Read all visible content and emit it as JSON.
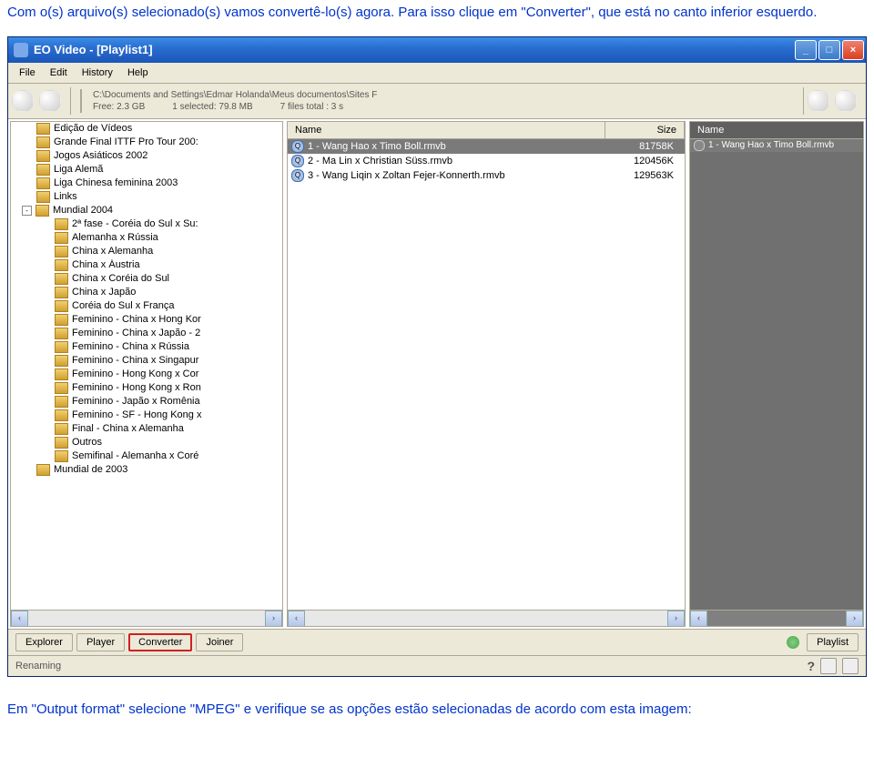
{
  "intro": "Com o(s) arquivo(s) selecionado(s) vamos convertê-lo(s) agora. Para isso clique em \"Converter\", que está no canto inferior esquerdo.",
  "outro": "Em \"Output format\" selecione \"MPEG\" e verifique se as opções estão selecionadas de acordo com esta imagem:",
  "title": "EO Video - [Playlist1]",
  "menu": {
    "file": "File",
    "edit": "Edit",
    "history": "History",
    "help": "Help"
  },
  "path": {
    "line1": "C:\\Documents and Settings\\Edmar Holanda\\Meus documentos\\Sites F",
    "free": "Free: 2.3 GB",
    "sel": "1 selected: 79.8 MB",
    "total": "7 files  total : 3 s"
  },
  "cols": {
    "name": "Name",
    "size": "Size"
  },
  "tree": [
    {
      "label": "Edição de Vídeos",
      "depth": 0
    },
    {
      "label": "Grande Final ITTF Pro Tour 200:",
      "depth": 0
    },
    {
      "label": "Jogos Asiáticos 2002",
      "depth": 0
    },
    {
      "label": "Liga Alemã",
      "depth": 0
    },
    {
      "label": "Liga Chinesa feminina 2003",
      "depth": 0
    },
    {
      "label": "Links",
      "depth": 0
    },
    {
      "label": "Mundial 2004",
      "depth": 0,
      "exp": "-"
    },
    {
      "label": "2ª fase - Coréia do Sul x Su:",
      "depth": 1
    },
    {
      "label": "Alemanha x Rússia",
      "depth": 1
    },
    {
      "label": "China x Alemanha",
      "depth": 1
    },
    {
      "label": "China x Áustria",
      "depth": 1
    },
    {
      "label": "China x Coréia do Sul",
      "depth": 1
    },
    {
      "label": "China x Japão",
      "depth": 1
    },
    {
      "label": "Coréia do Sul x França",
      "depth": 1
    },
    {
      "label": "Feminino - China x Hong Kor",
      "depth": 1
    },
    {
      "label": "Feminino - China x Japão - 2",
      "depth": 1
    },
    {
      "label": "Feminino - China x Rússia",
      "depth": 1
    },
    {
      "label": "Feminino - China x Singapur",
      "depth": 1
    },
    {
      "label": "Feminino - Hong Kong x Cor",
      "depth": 1
    },
    {
      "label": "Feminino - Hong Kong x Ron",
      "depth": 1
    },
    {
      "label": "Feminino - Japão x Romênia",
      "depth": 1
    },
    {
      "label": "Feminino - SF - Hong Kong x",
      "depth": 1
    },
    {
      "label": "Final - China x Alemanha",
      "depth": 1
    },
    {
      "label": "Outros",
      "depth": 1
    },
    {
      "label": "Semifinal - Alemanha x Coré",
      "depth": 1
    },
    {
      "label": "Mundial de 2003",
      "depth": 0
    }
  ],
  "files": [
    {
      "name": "1 - Wang Hao x Timo Boll.rmvb",
      "size": "81758K",
      "sel": true
    },
    {
      "name": "2 - Ma Lin x Christian Süss.rmvb",
      "size": "120456K"
    },
    {
      "name": "3 - Wang Liqin x Zoltan Fejer-Konnerth.rmvb",
      "size": "129563K"
    }
  ],
  "playlist": [
    {
      "name": "1 - Wang Hao x Timo Boll.rmvb"
    }
  ],
  "tabs": {
    "explorer": "Explorer",
    "player": "Player",
    "converter": "Converter",
    "joiner": "Joiner",
    "playlist": "Playlist"
  },
  "status": {
    "left": "Renaming",
    "help": "?"
  }
}
